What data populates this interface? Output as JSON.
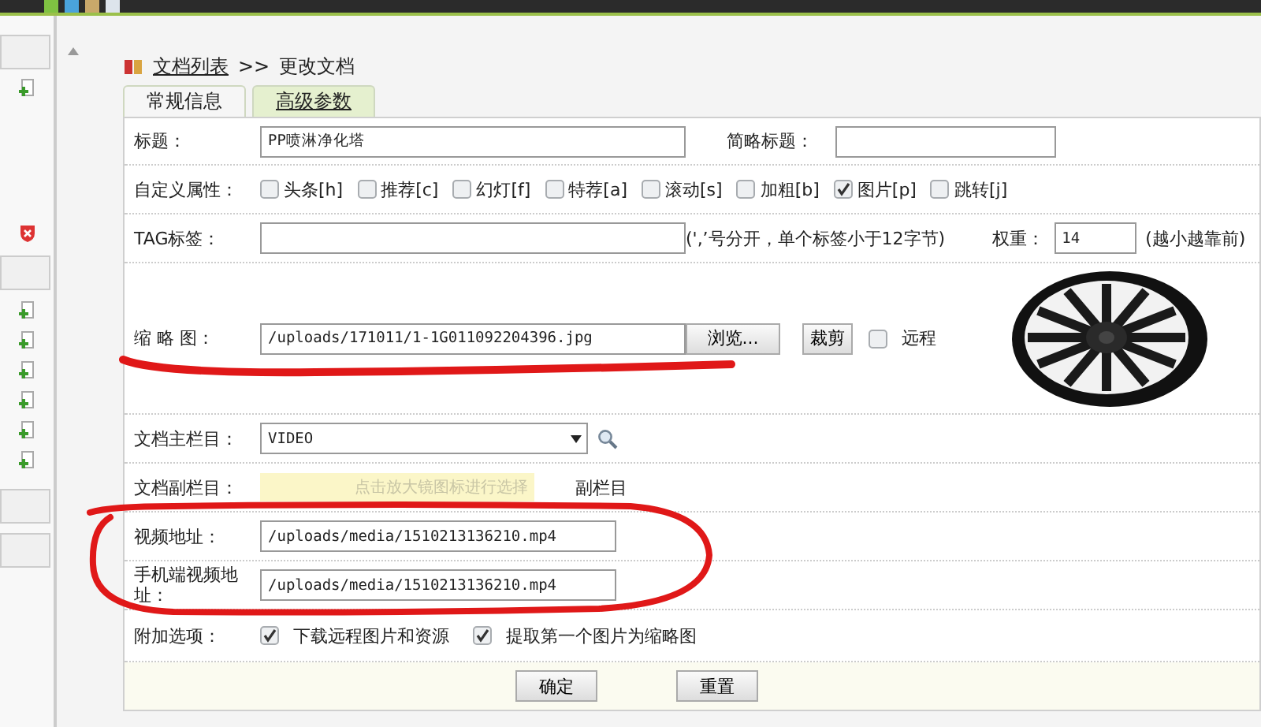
{
  "breadcrumb": {
    "link": "文档列表",
    "separator": ">>",
    "current": "更改文档"
  },
  "tabs": [
    {
      "label": "常规信息",
      "selected": false
    },
    {
      "label": "高级参数",
      "selected": true
    }
  ],
  "rows": [
    {
      "kind": "title",
      "label": "标题：",
      "value": "PP喷淋净化塔",
      "short_label": "简略标题："
    },
    {
      "kind": "flags",
      "label": "自定义属性：",
      "options": [
        {
          "text": "头条[h]",
          "checked": false
        },
        {
          "text": "推荐[c]",
          "checked": false
        },
        {
          "text": "幻灯[f]",
          "checked": false
        },
        {
          "text": "特荐[a]",
          "checked": false
        },
        {
          "text": "滚动[s]",
          "checked": false
        },
        {
          "text": "加粗[b]",
          "checked": false
        },
        {
          "text": "图片[p]",
          "checked": true
        },
        {
          "text": "跳转[j]",
          "checked": false
        }
      ]
    },
    {
      "kind": "tag",
      "label": "TAG标签：",
      "hint": "(',’号分开，单个标签小于12字节)",
      "weight_label": "权重：",
      "weight": "14",
      "weight_hint": "(越小越靠前)"
    },
    {
      "kind": "thumb",
      "label": "缩 略 图：",
      "value": "/uploads/171011/1-1G011092204396.jpg",
      "browse": "浏览...",
      "crop": "裁剪",
      "remote": {
        "text": "远程",
        "checked": false
      }
    },
    {
      "kind": "select",
      "label": "文档主栏目：",
      "value": "VIDEO"
    },
    {
      "kind": "subcol",
      "label": "文档副栏目：",
      "placeholder": "点击放大镜图标进行选择",
      "link": "副栏目"
    },
    {
      "kind": "text",
      "label": "视频地址：",
      "value": "/uploads/media/1510213136210.mp4"
    },
    {
      "kind": "text",
      "label": "手机端视频地址：",
      "value": "/uploads/media/1510213136210.mp4"
    },
    {
      "kind": "options",
      "label": "附加选项：",
      "options": [
        {
          "text": "下载远程图片和资源",
          "checked": true
        },
        {
          "text": "提取第一个图片为缩略图",
          "checked": true
        }
      ]
    }
  ],
  "buttons": [
    "确定",
    "重置"
  ]
}
